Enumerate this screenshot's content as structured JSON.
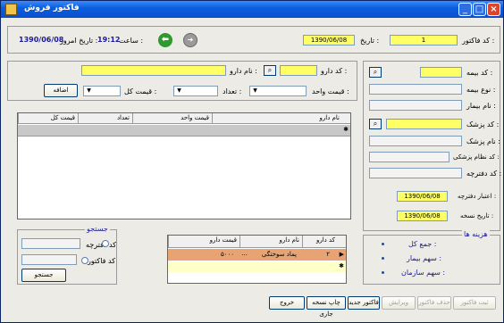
{
  "window": {
    "title": "فاکتور فروش"
  },
  "header": {
    "invoice_code_label": "کد فاکتور :",
    "invoice_code_value": "1",
    "date_label": "تاریخ :",
    "date_value": "1390/06/08",
    "time_label": "ساعت :",
    "time_value": "19:12",
    "today_label": "تاریخ امروز :",
    "today_value": "1390/06/08"
  },
  "patient": {
    "insurance_code_label": "کد بیمه :",
    "insurance_type_label": "نوع بیمه :",
    "patient_name_label": "نام بیمار :",
    "doctor_code_label": "کد پزشک :",
    "doctor_name_label": "نام پزشک :",
    "medical_system_code_label": "کد نظام پزشکی :",
    "booklet_code_label": "کد دفترچه :",
    "booklet_validity_label": "اعتبار دفترچه :",
    "booklet_validity_value": "1390/06/08",
    "prescription_date_label": "تاریخ نسخه :",
    "prescription_date_value": "1390/06/08"
  },
  "drug_entry": {
    "drug_code_label": "کد دارو :",
    "drug_name_label": "نام دارو :",
    "unit_price_label": "قیمت واحد :",
    "count_label": "تعداد :",
    "total_price_label": "قیمت کل :",
    "add_button": "اضافه"
  },
  "items_grid": {
    "columns": [
      "نام دارو",
      "قیمت واحد",
      "تعداد",
      "قیمت کل"
    ]
  },
  "cost": {
    "title": "هزینه ها",
    "total_label": "جمع کل :",
    "patient_share_label": "سهم بیمار :",
    "org_share_label": "سهم سازمان :"
  },
  "search": {
    "title": "جستجو",
    "booklet_code_label": "کد دفترچه",
    "invoice_code_label": "کد فاکتور",
    "search_button": "جستجو"
  },
  "mini_grid": {
    "columns": [
      "کد دارو",
      "نام دارو",
      "قیمت دارو"
    ],
    "rows": [
      {
        "code": "۲",
        "name": "پماد سوختگی",
        "price": "۵۰۰۰",
        "name_suffix": "..."
      }
    ]
  },
  "footer": {
    "register_button": "ثبت فاکتور",
    "delete_button": "حذف فاکتور",
    "edit_button": "ویرایش",
    "new_button": "فاکتور جدید",
    "print_button": "چاپ نسخه جاری",
    "exit_button": "خروج"
  }
}
